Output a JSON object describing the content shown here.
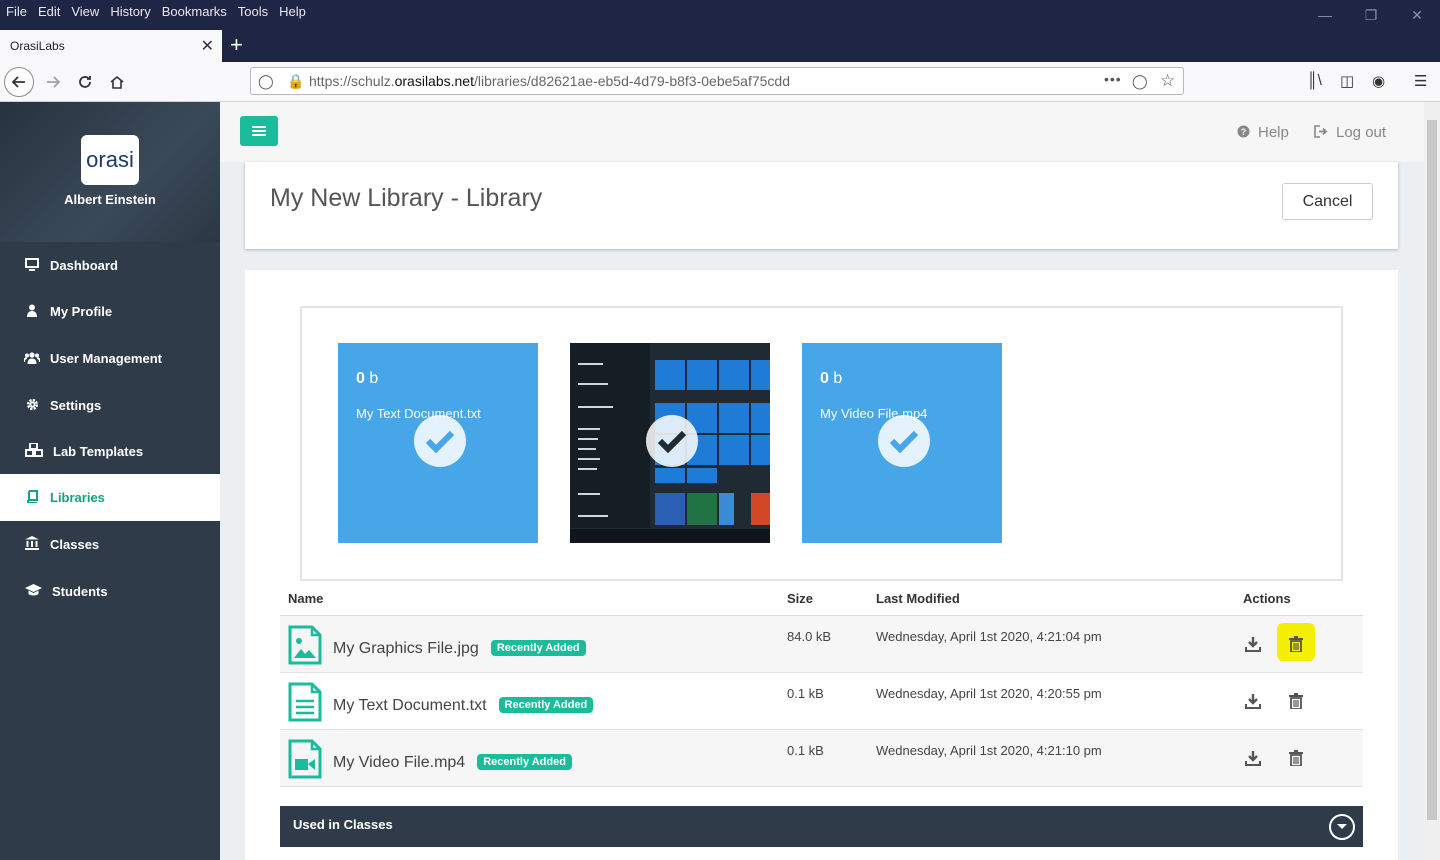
{
  "browser": {
    "menu": [
      "File",
      "Edit",
      "View",
      "History",
      "Bookmarks",
      "Tools",
      "Help"
    ],
    "tab_title": "OrasiLabs",
    "url_prefix": "https://schulz.",
    "url_domain": "orasilabs.net",
    "url_path": "/libraries/d82621ae-eb5d-4d79-b8f3-0ebe5af75cdd"
  },
  "sidebar": {
    "logo_text": "orasi",
    "user_name": "Albert Einstein",
    "items": [
      {
        "label": "Dashboard",
        "icon": "monitor-icon"
      },
      {
        "label": "My Profile",
        "icon": "user-icon"
      },
      {
        "label": "User Management",
        "icon": "users-icon"
      },
      {
        "label": "Settings",
        "icon": "gear-icon"
      },
      {
        "label": "Lab Templates",
        "icon": "cubes-icon"
      },
      {
        "label": "Libraries",
        "icon": "book-icon",
        "active": true
      },
      {
        "label": "Classes",
        "icon": "bank-icon"
      },
      {
        "label": "Students",
        "icon": "graduation-cap-icon"
      }
    ]
  },
  "topbar": {
    "help_label": "Help",
    "logout_label": "Log out"
  },
  "page": {
    "title": "My New Library - Library",
    "cancel_label": "Cancel"
  },
  "tiles": [
    {
      "size_num": "0",
      "size_unit": "b",
      "name": "My Text Document.txt",
      "type": "text"
    },
    {
      "type": "image",
      "name": ""
    },
    {
      "size_num": "0",
      "size_unit": "b",
      "name": "My Video File.mp4",
      "type": "video"
    }
  ],
  "table": {
    "headers": {
      "name": "Name",
      "size": "Size",
      "modified": "Last Modified",
      "actions": "Actions"
    },
    "rows": [
      {
        "name": "My Graphics File.jpg",
        "badge": "Recently Added",
        "size": "84.0 kB",
        "modified": "Wednesday, April 1st 2020, 4:21:04 pm",
        "icon": "image-file-icon"
      },
      {
        "name": "My Text Document.txt",
        "badge": "Recently Added",
        "size": "0.1 kB",
        "modified": "Wednesday, April 1st 2020, 4:20:55 pm",
        "icon": "text-file-icon"
      },
      {
        "name": "My Video File.mp4",
        "badge": "Recently Added",
        "size": "0.1 kB",
        "modified": "Wednesday, April 1st 2020, 4:21:10 pm",
        "icon": "video-file-icon"
      }
    ]
  },
  "used_in_classes": {
    "label": "Used in Classes"
  },
  "colors": {
    "accent": "#1abc9c",
    "sidebar": "#2f3b48",
    "tile": "#46a6e8",
    "highlight": "#f5f000"
  }
}
